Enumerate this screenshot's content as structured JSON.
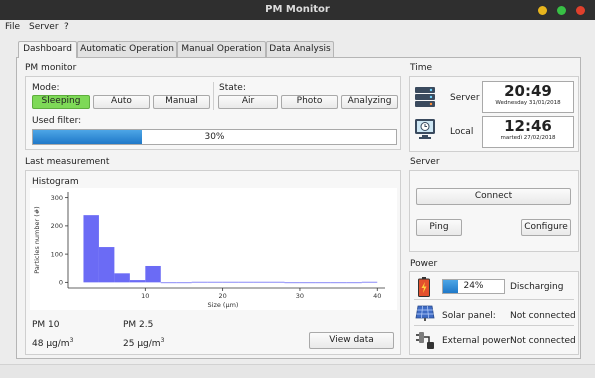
{
  "window": {
    "title": "PM Monitor",
    "buttons": {
      "minimize": "#e8b51d",
      "maximize": "#38c045",
      "close": "#e0402c"
    }
  },
  "menu": {
    "items": [
      "File",
      "Server",
      "?"
    ]
  },
  "tabs": [
    {
      "label": "Dashboard",
      "active": true
    },
    {
      "label": "Automatic Operation",
      "active": false
    },
    {
      "label": "Manual Operation",
      "active": false
    },
    {
      "label": "Data Analysis",
      "active": false
    }
  ],
  "pm_monitor": {
    "title": "PM monitor",
    "mode_label": "Mode:",
    "modes": [
      "Sleeping",
      "Auto",
      "Manual"
    ],
    "selected_mode": "Sleeping",
    "state_label": "State:",
    "states": [
      "Air",
      "Photo",
      "Analyzing"
    ],
    "filter_label": "Used filter:",
    "filter_percent": 30,
    "filter_text": "30%"
  },
  "time": {
    "title": "Time",
    "server_label": "Server",
    "server_time": "20:49",
    "server_date": "Wednesday 31/01/2018",
    "local_label": "Local",
    "local_time": "12:46",
    "local_date": "martedì 27/02/2018"
  },
  "last_measurement": {
    "title": "Last measurement",
    "histogram_label": "Histogram",
    "pm10_label": "PM 10",
    "pm10_value": "48 μg/m",
    "pm25_label": "PM 2.5",
    "pm25_value": "25 μg/m",
    "unit_exponent": "3",
    "view_button": "View data"
  },
  "chart_data": {
    "type": "bar",
    "title": "",
    "xlabel": "Size (μm)",
    "ylabel": "Particles number (#)",
    "xlim": [
      0,
      41
    ],
    "ylim": [
      -20,
      320
    ],
    "xticks": [
      10,
      20,
      30,
      40
    ],
    "yticks": [
      0,
      100,
      200,
      300
    ],
    "x_tick_labels": [
      "10",
      "20",
      "30",
      "40"
    ],
    "y_tick_labels": [
      "0",
      "100",
      "200",
      "300"
    ],
    "bar_color": "#6b6bf5",
    "x": [
      3,
      5,
      7,
      9,
      11,
      13,
      15,
      17,
      19,
      21,
      23,
      25,
      27,
      29,
      31,
      33,
      35,
      37,
      39
    ],
    "values": [
      238,
      125,
      32,
      8,
      58,
      0,
      0,
      2,
      2,
      2,
      2,
      2,
      2,
      0,
      0,
      0,
      0,
      0,
      2
    ]
  },
  "server": {
    "title": "Server",
    "connect_button": "Connect",
    "ping_button": "Ping",
    "configure_button": "Configure"
  },
  "power": {
    "title": "Power",
    "battery_percent": 24,
    "battery_text": "24%",
    "battery_status": "Discharging",
    "solar_label": "Solar panel:",
    "solar_status": "Not connected",
    "external_label": "External power:",
    "external_status": "Not connected"
  }
}
